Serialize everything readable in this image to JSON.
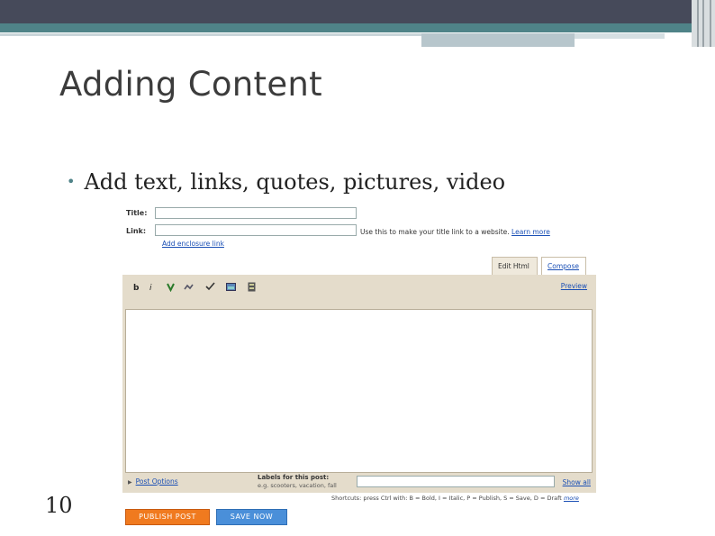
{
  "slide": {
    "title": "Adding Content",
    "bullet": "Add text, links, quotes, pictures, video",
    "number": "10"
  },
  "editor": {
    "title_label": "Title:",
    "link_label": "Link:",
    "link_hint": "Use this to make your title link to a website.",
    "learn_more": "Learn more",
    "add_enclosure": "Add enclosure link",
    "tabs": [
      "Edit Html",
      "Compose"
    ],
    "toolbar": {
      "bold": "b",
      "italic": "i",
      "icons": [
        "text-color-icon",
        "link-icon",
        "spellcheck-icon",
        "image-icon",
        "video-icon"
      ],
      "preview": "Preview"
    },
    "post_options": "Post Options",
    "labels_title": "Labels for this post:",
    "labels_example": "e.g. scooters, vacation, fall",
    "show_all": "Show all",
    "shortcuts": "Shortcuts: press Ctrl with: B = Bold, I = Italic, P = Publish, S = Save, D = Draft",
    "more": "more",
    "publish_button": "PUBLISH POST",
    "save_button": "SAVE NOW"
  },
  "colors": {
    "band_dark": "#464a5a",
    "band_teal": "#4f8388",
    "publish": "#f07a1f",
    "save": "#4a8fd9",
    "editor_frame": "#e4dccb"
  }
}
